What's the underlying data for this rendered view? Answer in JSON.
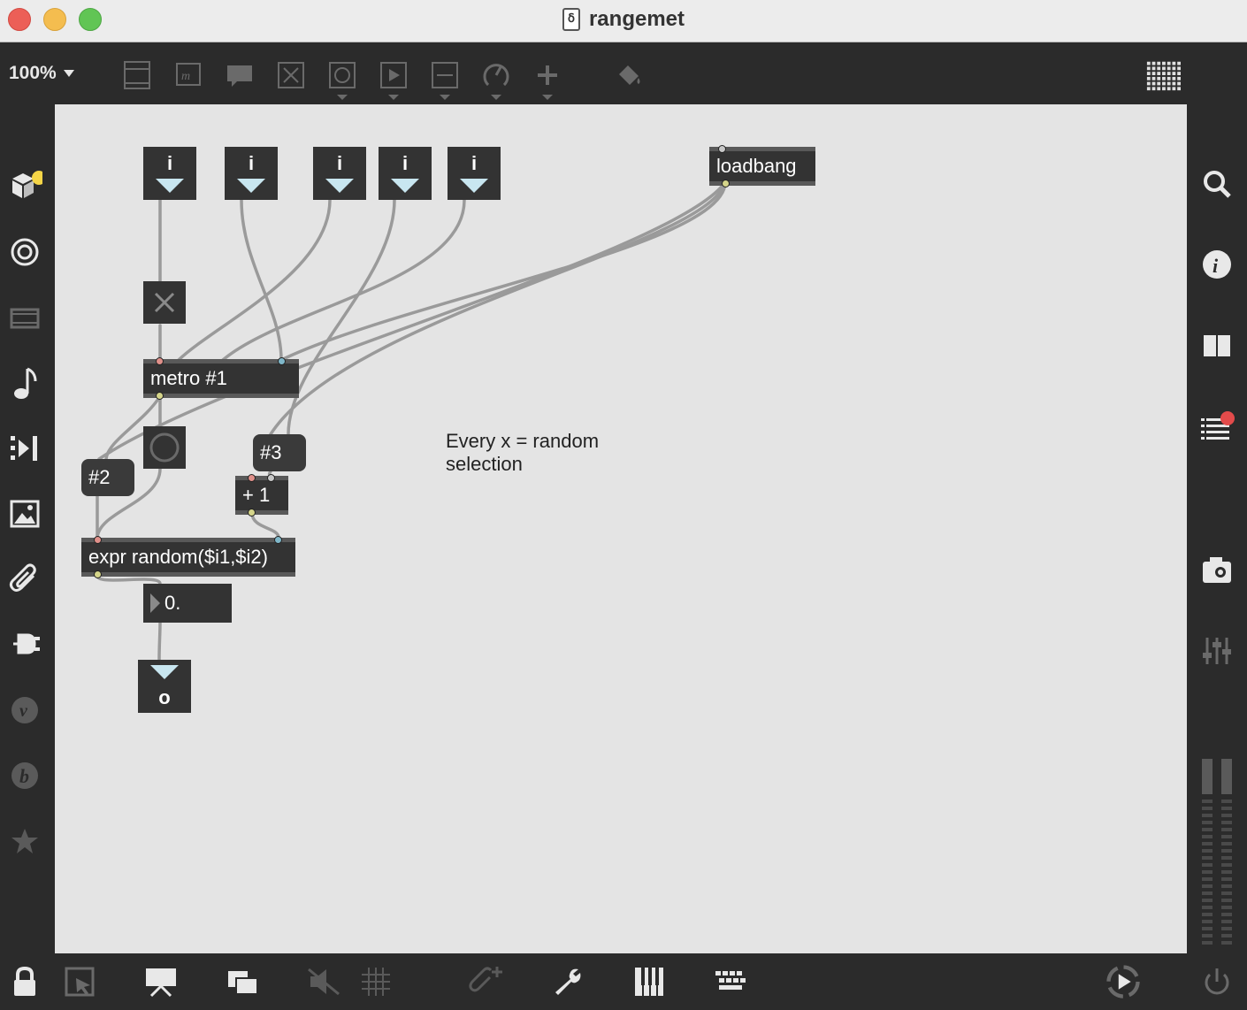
{
  "window": {
    "title": "rangemet",
    "doc_icon_glyph": "ẟ",
    "traffic_lights": {
      "close": "#ec5f57",
      "minimize": "#f4bd4f",
      "maximize": "#61c554"
    }
  },
  "toolbar": {
    "zoom": "100%",
    "tools": [
      "presentation-lines-icon",
      "message-icon",
      "comment-icon",
      "toggle-icon",
      "button-icon",
      "play-icon",
      "slider-icon",
      "dial-icon",
      "plus-icon",
      "paint-bucket-icon"
    ],
    "grid_icon": "patcher-grid-icon"
  },
  "left_sidebar": {
    "items": [
      "cube-icon",
      "target-icon",
      "film-icon",
      "music-note-icon",
      "sequence-icon",
      "image-icon",
      "paperclip-icon",
      "plug-icon",
      "v-icon",
      "b-icon",
      "star-icon"
    ],
    "badge_color": "#f5d547"
  },
  "right_sidebar": {
    "items": [
      "search-icon",
      "info-icon",
      "columns-icon",
      "list-icon",
      "camera-icon",
      "mixer-icon"
    ],
    "badge_color": "#e34b4b"
  },
  "patch": {
    "int_boxes": [
      "i",
      "i",
      "i",
      "i",
      "i"
    ],
    "loadbang": "loadbang",
    "metro": "metro #1",
    "msg2": "#2",
    "msg3": "#3",
    "plus": "+ 1",
    "expr": "expr random($i1,$i2)",
    "float": "0.",
    "outlet_label": "o",
    "comment": "Every x = random selection",
    "colors": {
      "canvas": "#e4e4e4",
      "object": "#333333",
      "cord": "#9a9a9a",
      "inlet_left": "#e0908a",
      "inlet_right": "#7fb7c9",
      "outlet": "#d5d58a"
    }
  },
  "bottom_bar": {
    "items": [
      "lock-icon",
      "select-icon",
      "presentation-icon",
      "windows-icon",
      "mute-icon",
      "grid-icon",
      "attach-icon",
      "wrench-icon",
      "piano-icon",
      "keyboard-icon",
      "transport-icon",
      "power-icon"
    ]
  }
}
